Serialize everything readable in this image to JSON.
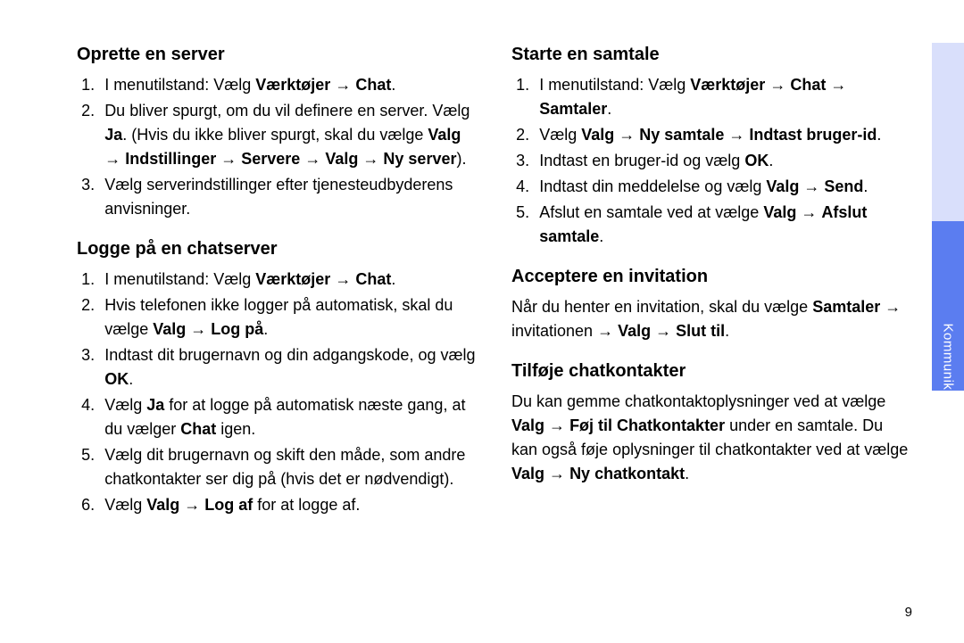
{
  "arrow": "→",
  "page_number": "9",
  "side_tab_label": "Kommunikation",
  "left": {
    "section1": {
      "title": "Oprette en server",
      "items": [
        {
          "pre": "I menutilstand: Vælg ",
          "seq": [
            "Værktøjer",
            "Chat"
          ],
          "post": "."
        },
        {
          "pre": "Du bliver spurgt, om du vil definere en server. Vælg ",
          "bold1": "Ja",
          "mid1": ". (Hvis du ikke bliver spurgt, skal du vælge ",
          "seq": [
            "Valg",
            "Indstillinger",
            "Servere",
            "Valg",
            "Ny server"
          ],
          "post": ")."
        },
        {
          "text": "Vælg serverindstillinger efter tjenesteudbyderens anvisninger."
        }
      ]
    },
    "section2": {
      "title": "Logge på en chatserver",
      "items": [
        {
          "pre": "I menutilstand: Vælg ",
          "seq": [
            "Værktøjer",
            "Chat"
          ],
          "post": "."
        },
        {
          "pre": "Hvis telefonen ikke logger på automatisk, skal du vælge ",
          "seq": [
            "Valg",
            "Log på"
          ],
          "post": "."
        },
        {
          "pre": "Indtast dit brugernavn og din adgangskode, og vælg ",
          "bold1": "OK",
          "post": "."
        },
        {
          "pre": "Vælg ",
          "bold1": "Ja",
          "mid1": " for at logge på automatisk næste gang, at du vælger ",
          "bold2": "Chat",
          "post": " igen."
        },
        {
          "text": "Vælg dit brugernavn og skift den måde, som andre chatkontakter ser dig på (hvis det er nødvendigt)."
        },
        {
          "pre": "Vælg ",
          "seq": [
            "Valg",
            "Log af"
          ],
          "post": " for at logge af."
        }
      ]
    }
  },
  "right": {
    "section1": {
      "title": "Starte en samtale",
      "items": [
        {
          "pre": "I menutilstand: Vælg ",
          "seq": [
            "Værktøjer",
            "Chat",
            "Samtaler"
          ],
          "post": "."
        },
        {
          "pre": "Vælg ",
          "seq": [
            "Valg",
            "Ny samtale",
            "Indtast bruger-id"
          ],
          "post": "."
        },
        {
          "pre": "Indtast en bruger-id og vælg ",
          "bold1": "OK",
          "post": "."
        },
        {
          "pre": "Indtast din meddelelse og vælg ",
          "seq": [
            "Valg",
            "Send"
          ],
          "post": "."
        },
        {
          "pre": "Afslut en samtale ved at vælge ",
          "seq": [
            "Valg",
            "Afslut samtale"
          ],
          "post": "."
        }
      ]
    },
    "section2": {
      "title": "Acceptere en invitation",
      "para": {
        "pre": "Når du henter en invitation, skal du vælge ",
        "seq_parts": [
          {
            "bold": "Samtaler"
          },
          {
            "plain": "invitationen"
          },
          {
            "bold": "Valg"
          },
          {
            "bold": "Slut til"
          }
        ],
        "post": "."
      }
    },
    "section3": {
      "title": "Tilføje chatkontakter",
      "para": {
        "pre": "Du kan gemme chatkontaktoplysninger ved at vælge ",
        "seq1": [
          "Valg",
          "Føj til Chatkontakter"
        ],
        "mid": " under en samtale. Du kan også føje oplysninger til chatkontakter ved at vælge ",
        "seq2": [
          "Valg",
          "Ny chatkontakt"
        ],
        "post": "."
      }
    }
  }
}
